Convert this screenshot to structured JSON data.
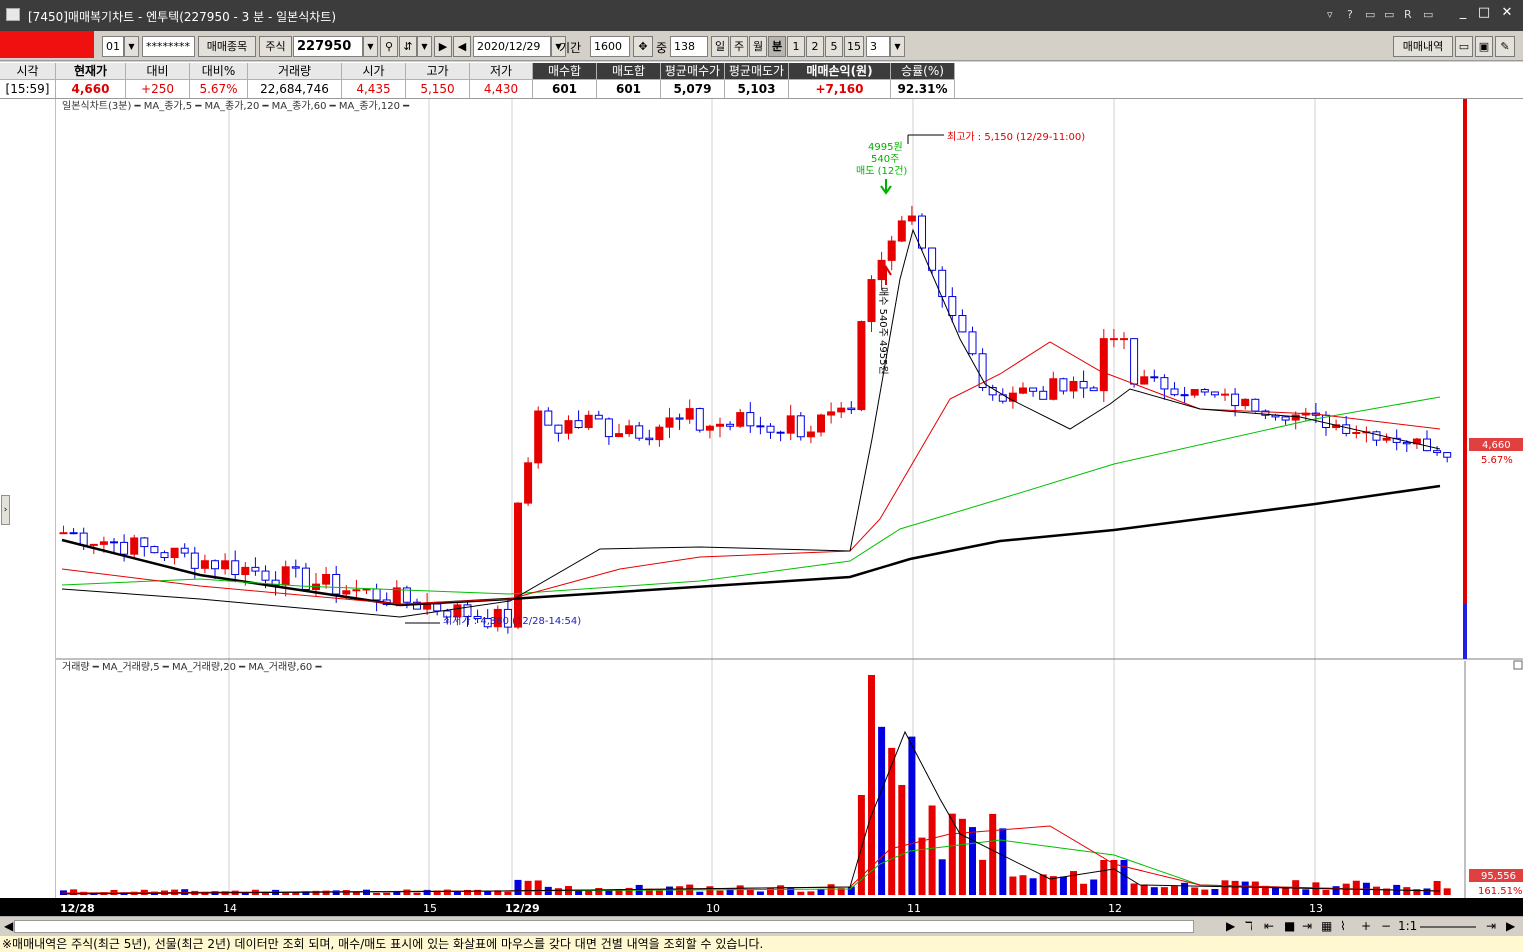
{
  "window": {
    "title": "[7450]매매복기차트 - 엔투텍(227950 - 3 분 - 일본식차트)",
    "controls": [
      "_",
      "□",
      "✕"
    ],
    "tool_icons": [
      "▿",
      "?",
      "▭",
      "▭",
      "R",
      "▭"
    ]
  },
  "toolbar": {
    "account_no": "01",
    "password": "********",
    "trade_items_label": "매매종목",
    "market_label": "주식",
    "code": "227950",
    "date": "2020/12/29",
    "period_label": "기간",
    "period_value": "1600",
    "mid_label": "중",
    "mid_value": "138",
    "timeframes": [
      "일",
      "주",
      "월",
      "분",
      "1",
      "2",
      "5",
      "15"
    ],
    "minute_select": "3",
    "trade_history_label": "매매내역"
  },
  "info": {
    "headers": [
      "시각",
      "현재가",
      "대비",
      "대비%",
      "거래량",
      "시가",
      "고가",
      "저가",
      "매수합",
      "매도합",
      "평균매수가",
      "평균매도가",
      "매매손익(원)",
      "승률(%)"
    ],
    "values": [
      "[15:59]",
      "4,660",
      "+250",
      "5.67%",
      "22,684,746",
      "4,435",
      "5,150",
      "4,430",
      "601",
      "601",
      "5,079",
      "5,103",
      "+7,160",
      "92.31%"
    ]
  },
  "price_pane": {
    "legend": "일본식차트(3분) ━ MA_종가,5 ━ MA_종가,20 ━ MA_종가,60 ━ MA_종가,120 ━",
    "high_note": "최고가 : 5,150 (12/29-11:00)",
    "low_note": "최저가 : 4,380 (12/28-14:54)",
    "sell_note": [
      "4995원",
      "540주",
      "매도 (12건)"
    ],
    "buy_note": "매수 540주 4955원",
    "last_price": "4,660",
    "last_pct": "5.67%"
  },
  "volume_pane": {
    "legend": "거래량 ━ MA_거래량,5 ━ MA_거래량,20 ━ MA_거래량,60 ━",
    "last_volume": "95,556",
    "last_pct": "161.51%"
  },
  "xaxis": {
    "labels": [
      "12/28",
      "14",
      "15",
      "12/29",
      "10",
      "11",
      "12",
      "13"
    ]
  },
  "statusbar": {
    "zoom": "1:1"
  },
  "notice": "※매매내역은 주식(최근 5년), 선물(최근 2년) 데이터만 조회 되며, 매수/매도 표시에 있는 화살표에 마우스를 갖다 대면 건별 내역을 조회할 수 있습니다.",
  "colors": {
    "up": "#e60000",
    "down": "#0000e0",
    "ma5": "#000000",
    "ma20": "#e60000",
    "ma60": "#00c000",
    "ma120": "#000000"
  }
}
